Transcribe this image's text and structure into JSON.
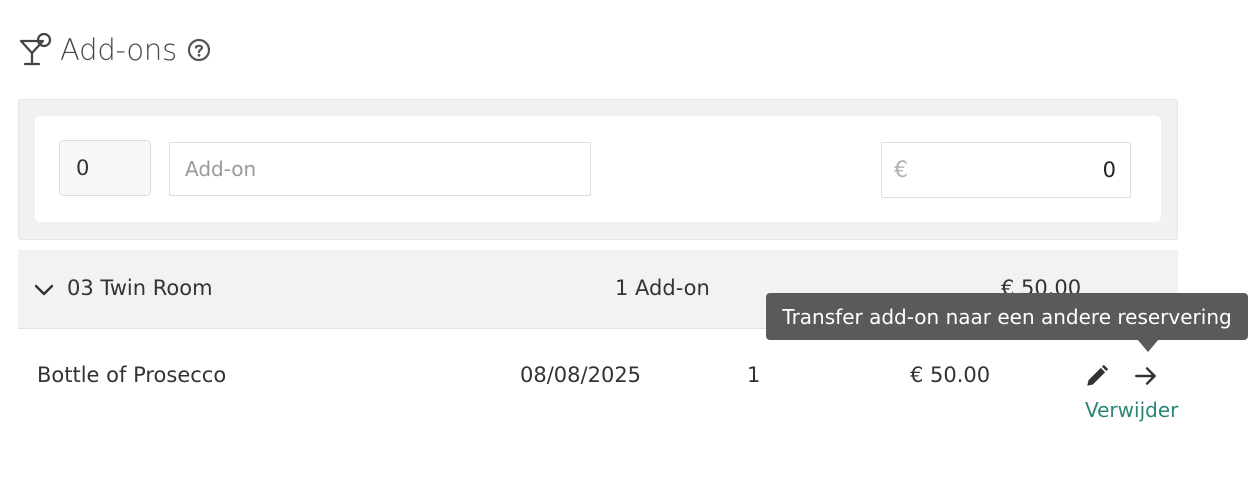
{
  "header": {
    "title": "Add-ons",
    "title_icon": "cocktail-icon",
    "help_icon": "help-circle-icon"
  },
  "form": {
    "quantity_value": "0",
    "addon_placeholder": "Add-on",
    "addon_value": "",
    "currency_symbol": "€",
    "price_value": "0"
  },
  "group": {
    "name": "03 Twin Room",
    "count_label": "1 Add-on",
    "total": "€ 50.00",
    "chevron_icon": "chevron-down-icon"
  },
  "items": [
    {
      "name": "Bottle of Prosecco",
      "date": "08/08/2025",
      "quantity": "1",
      "price": "€ 50.00",
      "edit_icon": "pencil-icon",
      "transfer_icon": "arrow-right-icon",
      "delete_label": "Verwijder"
    }
  ],
  "tooltip": {
    "text": "Transfer add-on naar een andere reservering"
  },
  "colors": {
    "link": "#2a8577",
    "tooltip_bg": "#5a5a5a",
    "panel_bg": "#f1f1f1"
  }
}
